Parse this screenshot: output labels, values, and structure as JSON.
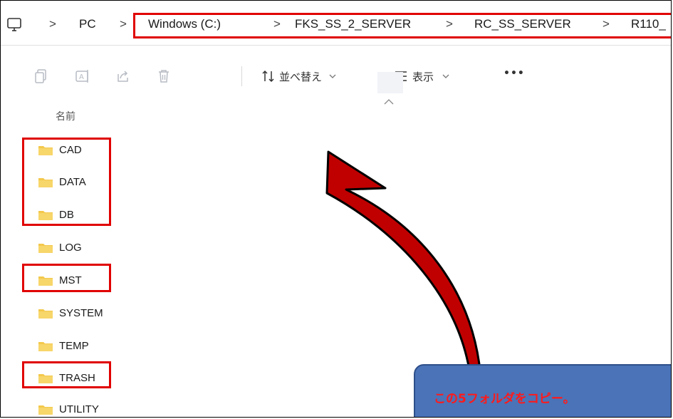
{
  "breadcrumb": {
    "items": [
      "PC",
      "Windows (C:)",
      "FKS_SS_2_SERVER",
      "RC_SS_SERVER",
      "R110_"
    ],
    "separator": ">"
  },
  "toolbar": {
    "copy_icon": "copy-icon",
    "rename_icon": "rename-icon",
    "share_icon": "share-icon",
    "delete_icon": "delete-icon",
    "sort_label": "並べ替え",
    "view_label": "表示",
    "more_label": "•••"
  },
  "list": {
    "column_name": "名前",
    "folders": [
      "CAD",
      "DATA",
      "DB",
      "LOG",
      "MST",
      "SYSTEM",
      "TEMP",
      "TRASH",
      "UTILITY"
    ]
  },
  "annotation": {
    "callout_text": "この5フォルダをコピー。",
    "highlight_color": "#e00000",
    "arrow_color": "#c00000",
    "callout_color": "#4a73b8"
  }
}
